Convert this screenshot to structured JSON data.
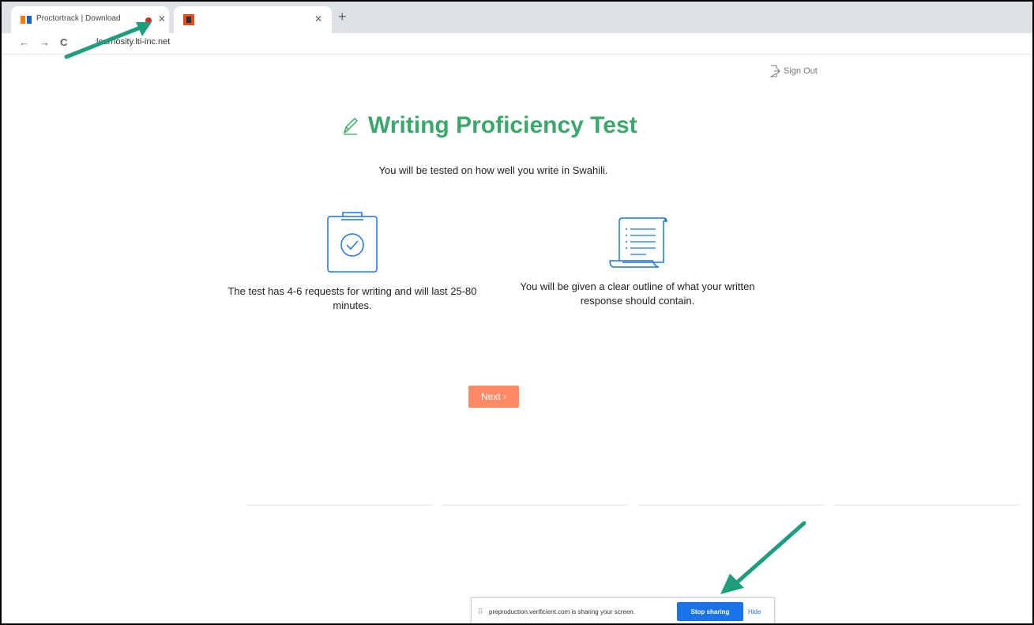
{
  "browser": {
    "tabs": [
      {
        "title": "Proctortrack | Download",
        "recording": true
      },
      {
        "title": ""
      }
    ],
    "url": "learnosity.lti-inc.net"
  },
  "page": {
    "sign_out": "Sign Out",
    "title": "Writing Proficiency Test",
    "subtitle": "You will be tested on how well you write in Swahili.",
    "info_cards": [
      {
        "icon": "clipboard-check-icon",
        "text": "The test has 4-6 requests for writing and will last 25-80 minutes."
      },
      {
        "icon": "scroll-document-icon",
        "text": "You will be given a clear outline of what your written response should contain."
      }
    ],
    "next_button": "Next ›"
  },
  "share_bar": {
    "handle": "⠿",
    "message": "preproduction.verificient.com is sharing your screen.",
    "stop_label": "Stop sharing",
    "hide_label": "Hide"
  },
  "colors": {
    "title": "#3aa86b",
    "next_button": "#ff8a65",
    "icon_blue": "#1a73e8",
    "annotation_arrow": "#1e9e7f",
    "record_dot": "#d93025"
  }
}
